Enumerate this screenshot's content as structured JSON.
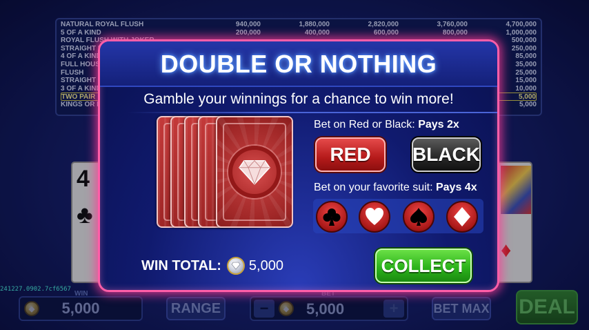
{
  "paytable": {
    "rows": [
      {
        "name": "NATURAL ROYAL FLUSH",
        "values": [
          "940,000",
          "1,880,000",
          "2,820,000",
          "3,760,000",
          "4,700,000"
        ]
      },
      {
        "name": "5 OF A KIND",
        "values": [
          "200,000",
          "400,000",
          "600,000",
          "800,000",
          "1,000,000"
        ]
      },
      {
        "name": "ROYAL FLUSH WITH JOKER",
        "values": [
          "",
          "",
          "",
          "",
          "500,000"
        ]
      },
      {
        "name": "STRAIGHT FLUSH",
        "values": [
          "",
          "",
          "",
          "",
          "250,000"
        ]
      },
      {
        "name": "4 OF A KIND",
        "values": [
          "",
          "",
          "",
          "",
          "85,000"
        ]
      },
      {
        "name": "FULL HOUSE",
        "values": [
          "",
          "",
          "",
          "",
          "35,000"
        ]
      },
      {
        "name": "FLUSH",
        "values": [
          "",
          "",
          "",
          "",
          "25,000"
        ]
      },
      {
        "name": "STRAIGHT",
        "values": [
          "",
          "",
          "",
          "",
          "15,000"
        ]
      },
      {
        "name": "3 OF A KIND",
        "values": [
          "",
          "",
          "",
          "",
          "10,000"
        ]
      },
      {
        "name": "TWO PAIR",
        "values": [
          "",
          "",
          "",
          "",
          "5,000"
        ],
        "highlighted": true
      },
      {
        "name": "KINGS OR BETTER",
        "values": [
          "",
          "",
          "",
          "",
          "5,000"
        ]
      }
    ]
  },
  "background_cards": {
    "left": {
      "rank": "4",
      "suit": "♣"
    },
    "right": {
      "suit": "♦"
    }
  },
  "debug_id": "241227.0902.7cf6567",
  "bottom_bar": {
    "win_label": "WIN",
    "win_value": "5,000",
    "range_label": "RANGE",
    "bet_label": "BET",
    "bet_value": "5,000",
    "minus_symbol": "−",
    "plus_symbol": "+",
    "bet_max_label": "BET MAX",
    "deal_label": "DEAL"
  },
  "modal": {
    "title": "DOUBLE OR NOTHING",
    "subtitle": "Gamble your winnings for a chance to win more!",
    "color_bet": {
      "prefix": "Bet on Red or Black:",
      "payout": "Pays 2x"
    },
    "red_label": "RED",
    "black_label": "BLACK",
    "suit_bet": {
      "prefix": "Bet on your favorite suit:",
      "payout": "Pays 4x"
    },
    "suits": [
      {
        "name": "clubs",
        "glyph": "♣"
      },
      {
        "name": "hearts",
        "glyph": "♥"
      },
      {
        "name": "spades",
        "glyph": "♠"
      },
      {
        "name": "diamonds",
        "glyph": "♦"
      }
    ],
    "win_total_label": "WIN TOTAL:",
    "win_total_value": "5,000",
    "collect_label": "COLLECT"
  },
  "colors": {
    "modal_border": "#ff5ea8",
    "red_button": "#b51a1a",
    "black_button": "#2a2a2a",
    "collect_button": "#2db41c",
    "suit_button": "#a81818"
  }
}
